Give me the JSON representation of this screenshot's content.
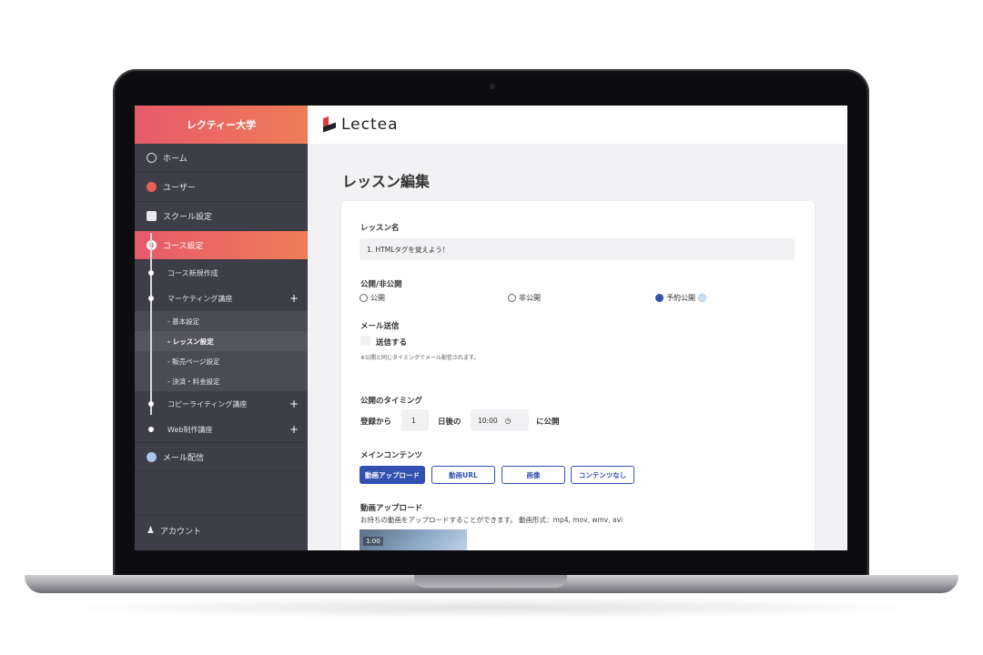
{
  "sidebar": {
    "brand": "レクティー大学",
    "items": [
      {
        "label": "ホーム",
        "icon": "gauge-icon"
      },
      {
        "label": "ユーザー",
        "icon": "user-icon"
      },
      {
        "label": "スクール設定",
        "icon": "school-icon"
      },
      {
        "label": "コース設定",
        "icon": "course-icon"
      }
    ],
    "sub_items": [
      {
        "label": "コース新規作成"
      },
      {
        "label": "マーケティング講座",
        "expand": "+"
      }
    ],
    "leaves": [
      "- 基本設定",
      "- レッスン設定",
      "- 販売ページ設定",
      "- 決済・料金設定"
    ],
    "sub_items_2": [
      {
        "label": "コピーライティング講座",
        "expand": "+"
      },
      {
        "label": "Web制作講座",
        "expand": "+"
      }
    ],
    "mail": "メール配信",
    "account": "アカウント",
    "accent": "#e65a6a"
  },
  "header": {
    "logo": "Lectea"
  },
  "page": {
    "title": "レッスン編集",
    "lesson_name_label": "レッスン名",
    "lesson_name_value": "1. HTMLタグを覚えよう！",
    "visibility_label": "公開/非公開",
    "visibility_options": [
      "公開",
      "非公開",
      "予約公開"
    ],
    "visibility_selected": "予約公開",
    "mail_label": "メール送信",
    "mail_checkbox": "送信する",
    "mail_note": "※公開と同じタイミングでメール配信されます。",
    "timing_label": "公開のタイミング",
    "timing_prefix": "登録から",
    "timing_days": "1",
    "timing_middle": "日後の",
    "timing_time": "10:00",
    "timing_suffix": "に公開",
    "content_label": "メインコンテンツ",
    "content_tabs": [
      "動画アップロード",
      "動画URL",
      "画像",
      "コンテンツなし"
    ],
    "content_selected": "動画アップロード",
    "upload_label": "動画アップロード",
    "upload_note": "お持ちの動画をアップロードすることができます。 動画形式：mp4, mov, wmv, avi",
    "thumb_time": "1:00",
    "primary_color": "#3150b0"
  }
}
